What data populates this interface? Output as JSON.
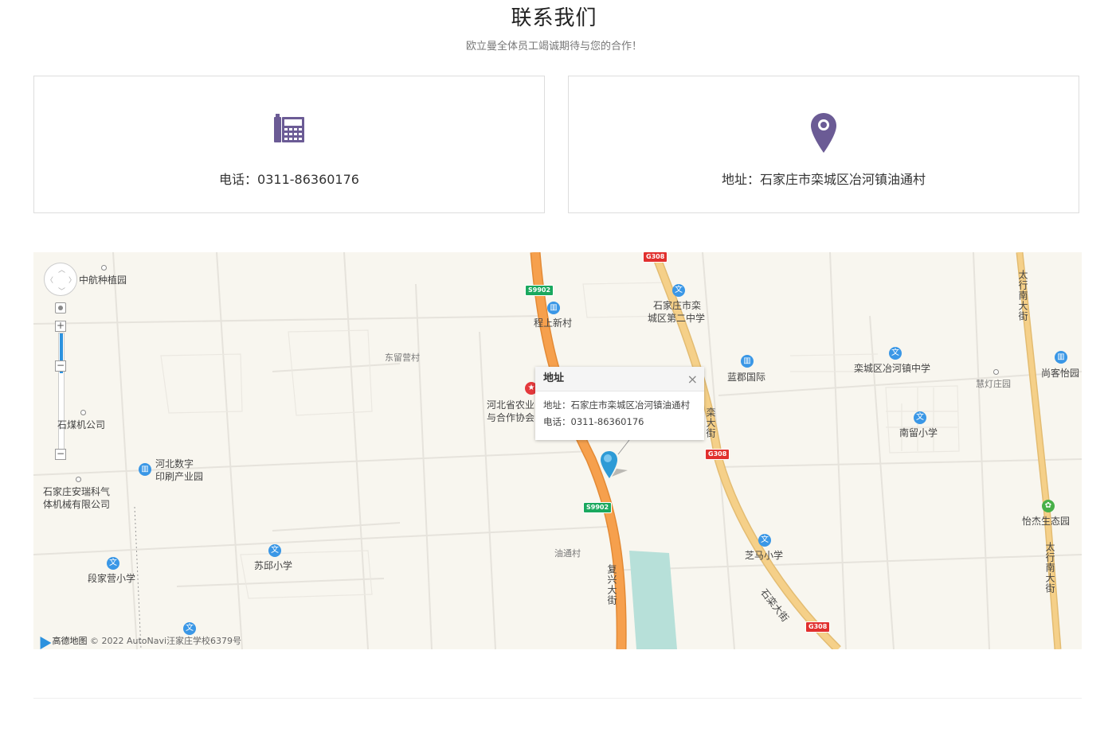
{
  "header": {
    "title": "联系我们",
    "subtitle": "欧立曼全体员工竭诚期待与您的合作！"
  },
  "contact_cards": {
    "phone": {
      "icon": "telephone-icon",
      "label": "电话：0311-86360176"
    },
    "address": {
      "icon": "map-pin-icon",
      "label": "地址：石家庄市栾城区冶河镇油通村"
    }
  },
  "map": {
    "popup": {
      "title": "地址",
      "close": "×",
      "address": "地址：石家庄市栾城区冶河镇油通村",
      "phone": "电话：0311-86360176"
    },
    "labels": {
      "zhonghang": "中航种植园",
      "chengshang": "程上新村",
      "dongliuying": "东留营村",
      "school2a": "石家庄市栾",
      "school2b": "城区第二中学",
      "lanjun": "蓝郡国际",
      "yehe_school": "栾城区冶河镇中学",
      "huideng": "慧灯庄园",
      "shangke": "尚客怡园",
      "meiji": "石煤机公司",
      "nongye_a": "河北省农业",
      "nongye_b": "与合作协会",
      "shuzi_a": "河北数字",
      "shuzi_b": "印刷产业园",
      "anrui_a": "石家庄安瑞科气",
      "anrui_b": "体机械有限公司",
      "nanliu": "南留小学",
      "yijie": "怡杰生态园",
      "duanjiaying": "段家营小学",
      "suqiu": "苏邱小学",
      "youtong": "油通村",
      "zhima": "芝马小学",
      "fuxing": "复兴大街",
      "taihang_top": "太行南大街",
      "taihang_bottom": "太行南大街",
      "shizhuang": "石栾大街",
      "road_mid": "栾大街"
    },
    "shields": {
      "s9902_top": "S9902",
      "s9902_bottom": "S9902",
      "g308_top": "G308",
      "g308_mid": "G308",
      "g308_bottom": "G308"
    },
    "attribution": {
      "logo": "高德地图",
      "text": "© 2022 AutoNavi汪家庄学校6379号"
    },
    "controls": {
      "zoom_in": "+",
      "zoom_out": "−",
      "zoom_out_bottom": "−"
    }
  },
  "colors": {
    "accent": "#6b5b95",
    "road_orange": "#f6a04d",
    "road_yellow": "#f5d089",
    "water": "#b7e0d9"
  }
}
